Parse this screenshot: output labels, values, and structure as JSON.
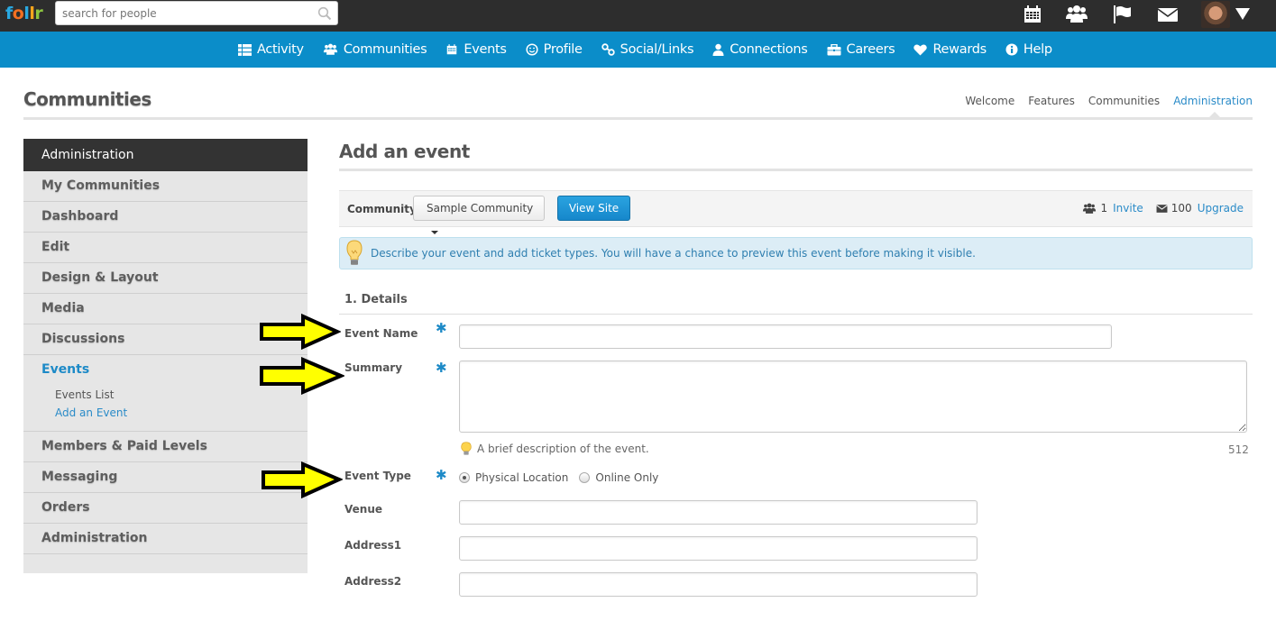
{
  "topbar": {
    "logo_letters": [
      "f",
      "o",
      "l",
      "l",
      "r"
    ],
    "search": {
      "placeholder": "search for people",
      "value": ""
    },
    "icons": [
      "calendar-icon",
      "people-icon",
      "flag-icon",
      "mail-icon",
      "avatar",
      "caret-down-icon"
    ]
  },
  "nav": {
    "items": [
      {
        "label": "Activity",
        "icon": "list-icon"
      },
      {
        "label": "Communities",
        "icon": "people-icon"
      },
      {
        "label": "Events",
        "icon": "calendar-icon"
      },
      {
        "label": "Profile",
        "icon": "smiley-icon"
      },
      {
        "label": "Social/Links",
        "icon": "link-icon"
      },
      {
        "label": "Connections",
        "icon": "user-icon"
      },
      {
        "label": "Careers",
        "icon": "briefcase-icon"
      },
      {
        "label": "Rewards",
        "icon": "heart-icon"
      },
      {
        "label": "Help",
        "icon": "info-icon"
      }
    ]
  },
  "header": {
    "title": "Communities",
    "breadcrumb": [
      "Welcome",
      "Features",
      "Communities",
      "Administration"
    ],
    "breadcrumb_active": "Administration"
  },
  "sidebar": {
    "heading": "Administration",
    "items": [
      {
        "label": "My Communities"
      },
      {
        "label": "Dashboard"
      },
      {
        "label": "Edit"
      },
      {
        "label": "Design & Layout"
      },
      {
        "label": "Media"
      },
      {
        "label": "Discussions"
      },
      {
        "label": "Events",
        "active": true,
        "sub": [
          "Events List",
          "Add an Event"
        ]
      },
      {
        "label": "Members & Paid Levels"
      },
      {
        "label": "Messaging"
      },
      {
        "label": "Orders"
      },
      {
        "label": "Administration"
      }
    ]
  },
  "main": {
    "title": "Add an event",
    "toolbar": {
      "community_label": "Community:",
      "community_selected": "Sample Community",
      "view_site": "View Site",
      "invite_count": "1",
      "invite_label": "Invite",
      "message_count": "100",
      "upgrade_label": "Upgrade"
    },
    "alert": "Describe your event and add ticket types. You will have a chance to preview this event before making it visible.",
    "section": "1. Details",
    "fields": {
      "event_name": {
        "label": "Event Name",
        "required": true,
        "value": ""
      },
      "summary": {
        "label": "Summary",
        "required": true,
        "value": "",
        "hint": "A brief description of the event.",
        "remaining": "512"
      },
      "event_type": {
        "label": "Event Type",
        "required": true,
        "options": [
          "Physical Location",
          "Online Only"
        ],
        "selected": "Physical Location"
      },
      "venue": {
        "label": "Venue",
        "value": ""
      },
      "address1": {
        "label": "Address1",
        "value": ""
      },
      "address2": {
        "label": "Address2",
        "value": ""
      }
    },
    "annotation_color": "#ffff00"
  },
  "colors": {
    "topbar_bg": "#2d2d2d",
    "nav_bg": "#0b8dc9",
    "accent": "#1d8ac7",
    "sidebar_bg": "#e6e6e6",
    "sidebar_head_bg": "#333333"
  }
}
